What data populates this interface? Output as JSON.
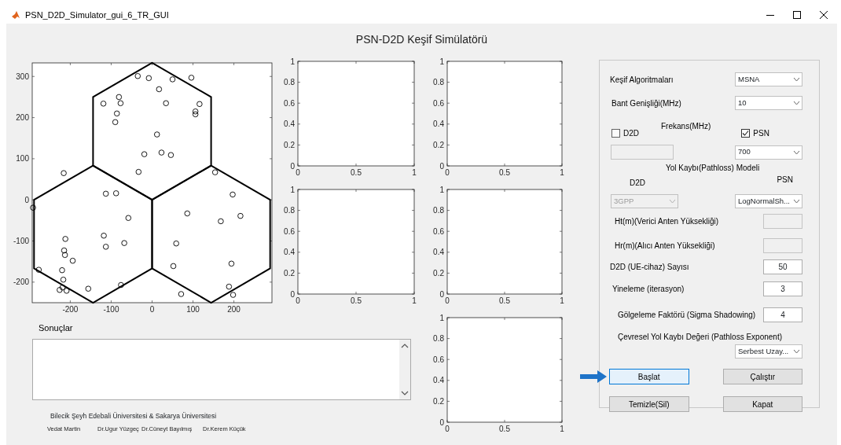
{
  "window": {
    "title": "PSN_D2D_Simulator_gui_6_TR_GUI"
  },
  "heading": "PSN-D2D Keşif Simülatörü",
  "map_plot": {
    "chart_data": {
      "type": "scatter",
      "xlim": [
        -293,
        293
      ],
      "ylim": [
        -250,
        333
      ],
      "xticks": [
        -200,
        -100,
        0,
        100,
        200
      ],
      "yticks": [
        -200,
        -100,
        0,
        100,
        200,
        300
      ],
      "x": [
        -35,
        -8,
        50,
        96,
        17,
        -119,
        -81,
        -77,
        34,
        116,
        106,
        106,
        -86,
        -90,
        12,
        -19,
        23,
        46,
        -33,
        -216,
        154,
        -113,
        -88,
        197,
        -291,
        -58,
        86,
        168,
        216,
        -212,
        -118,
        -68,
        -113,
        59,
        -215,
        -213,
        -194,
        -277,
        -220,
        -217,
        -219,
        -226,
        -209,
        -156,
        -76,
        52,
        194,
        188,
        198,
        71
      ],
      "series": [
        {
          "color": "#000000",
          "values": [
            301,
            296,
            293,
            297,
            269,
            234,
            250,
            235,
            235,
            233,
            215,
            208,
            210,
            189,
            159,
            111,
            115,
            109,
            68,
            65,
            67,
            15,
            16,
            13,
            -19,
            -44,
            -33,
            -52,
            -39,
            -95,
            -87,
            -105,
            -114,
            -106,
            -123,
            -134,
            -148,
            -170,
            -171,
            -194,
            -213,
            -219,
            -221,
            -216,
            -207,
            -161,
            -155,
            -211,
            -231,
            -229
          ]
        }
      ]
    }
  },
  "empty_plots": [
    {
      "chart_data": {
        "type": "line",
        "xlim": [
          0,
          1
        ],
        "ylim": [
          0,
          1
        ],
        "xticks": [
          0,
          0.5,
          1
        ],
        "yticks": [
          0,
          0.2,
          0.4,
          0.6,
          0.8,
          1
        ]
      }
    },
    {
      "chart_data": {
        "type": "line",
        "xlim": [
          0,
          1
        ],
        "ylim": [
          0,
          1
        ],
        "xticks": [
          0,
          0.5,
          1
        ],
        "yticks": [
          0,
          0.2,
          0.4,
          0.6,
          0.8,
          1
        ]
      }
    },
    {
      "chart_data": {
        "type": "line",
        "xlim": [
          0,
          1
        ],
        "ylim": [
          0,
          1
        ],
        "xticks": [
          0,
          0.5,
          1
        ],
        "yticks": [
          0,
          0.2,
          0.4,
          0.6,
          0.8,
          1
        ]
      }
    },
    {
      "chart_data": {
        "type": "line",
        "xlim": [
          0,
          1
        ],
        "ylim": [
          0,
          1
        ],
        "xticks": [
          0,
          0.5,
          1
        ],
        "yticks": [
          0,
          0.2,
          0.4,
          0.6,
          0.8,
          1
        ]
      }
    },
    {
      "chart_data": {
        "type": "line",
        "xlim": [
          0,
          1
        ],
        "ylim": [
          0,
          1
        ],
        "xticks": [
          0,
          0.5,
          1
        ],
        "yticks": [
          0,
          0.2,
          0.4,
          0.6,
          0.8,
          1
        ]
      }
    }
  ],
  "results": {
    "label": "Sonuçlar"
  },
  "credits": {
    "institution": "Bilecik Şeyh Edebali Üniversitesi & Sakarya Üniversitesi",
    "authors": [
      "Vedat Martin",
      "Dr.Ugur Yüzgeç",
      "Dr.Cüneyt Bayılmış",
      "Dr.Kerem Küçük"
    ]
  },
  "settings": {
    "algorithm": {
      "label": "Keşif Algoritmaları",
      "value": "MSNA"
    },
    "bandwidth": {
      "label": "Bant Genişliği(MHz)",
      "value": "10"
    },
    "frequency": {
      "label": "Frekans(MHz)",
      "d2d": {
        "label": "D2D",
        "checked": false,
        "disabled": true
      },
      "psn": {
        "label": "PSN",
        "checked": true,
        "value": "700"
      }
    },
    "pathloss_model": {
      "label": "Yol Kaybı(Pathloss) Modeli",
      "d2d": {
        "label": "D2D",
        "value": "3GPP",
        "disabled": true
      },
      "psn": {
        "label": "PSN",
        "value": "LogNormalSh...",
        "disabled": false
      }
    },
    "fields": [
      {
        "label": "Ht(m)(Verici Anten Yüksekliği)",
        "disabled": true
      },
      {
        "label": "Hr(m)(Alıcı Anten Yüksekliği)",
        "disabled": true
      },
      {
        "label": "D2D (UE-cihaz) Sayısı",
        "value": "50",
        "disabled": false
      },
      {
        "label": "Yineleme (iterasyon)",
        "value": "3",
        "disabled": false
      },
      {
        "label": "Gölgeleme Faktörü (Sigma Shadowing)",
        "value": "4",
        "disabled": false
      }
    ],
    "exponent": {
      "label": "Çevresel Yol Kaybı Değeri (Pathloss Exponent)",
      "value": "Serbest Uzay..."
    },
    "buttons": [
      {
        "label": "Başlat",
        "focused": true
      },
      {
        "label": "Çalıştır",
        "focused": false
      },
      {
        "label": "Temizle(Sil)",
        "focused": false
      },
      {
        "label": "Kapat",
        "focused": false
      }
    ]
  }
}
